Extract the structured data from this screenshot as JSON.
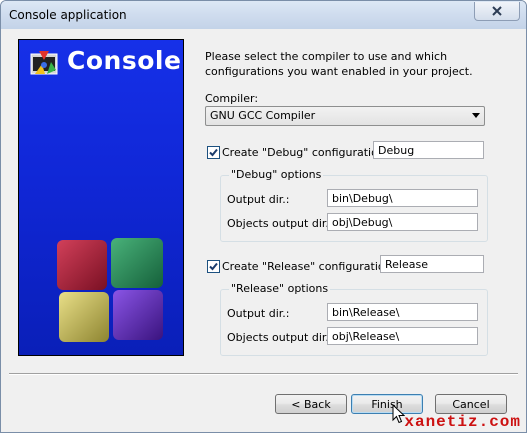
{
  "window": {
    "title": "Console application"
  },
  "banner": {
    "title": "Console"
  },
  "intro_text": "Please select the compiler to use and which configurations you want enabled in your project.",
  "compiler": {
    "label": "Compiler:",
    "selected": "GNU GCC Compiler"
  },
  "debug": {
    "checkbox_label": "Create \"Debug\" configuration:",
    "checked": true,
    "name_value": "Debug",
    "group_label": "\"Debug\" options",
    "output_dir_label": "Output dir.:",
    "output_dir_value": "bin\\Debug\\",
    "objects_dir_label": "Objects output dir.:",
    "objects_dir_value": "obj\\Debug\\"
  },
  "release": {
    "checkbox_label": "Create \"Release\" configuration:",
    "checked": true,
    "name_value": "Release",
    "group_label": "\"Release\" options",
    "output_dir_label": "Output dir.:",
    "output_dir_value": "bin\\Release\\",
    "objects_dir_label": "Objects output dir.:",
    "objects_dir_value": "obj\\Release\\"
  },
  "buttons": {
    "back": "< Back",
    "finish": "Finish",
    "cancel": "Cancel"
  },
  "watermark": "xanetiz.com",
  "colors": {
    "banner_blue": "#1027d6",
    "watermark_red": "#cc1111"
  }
}
